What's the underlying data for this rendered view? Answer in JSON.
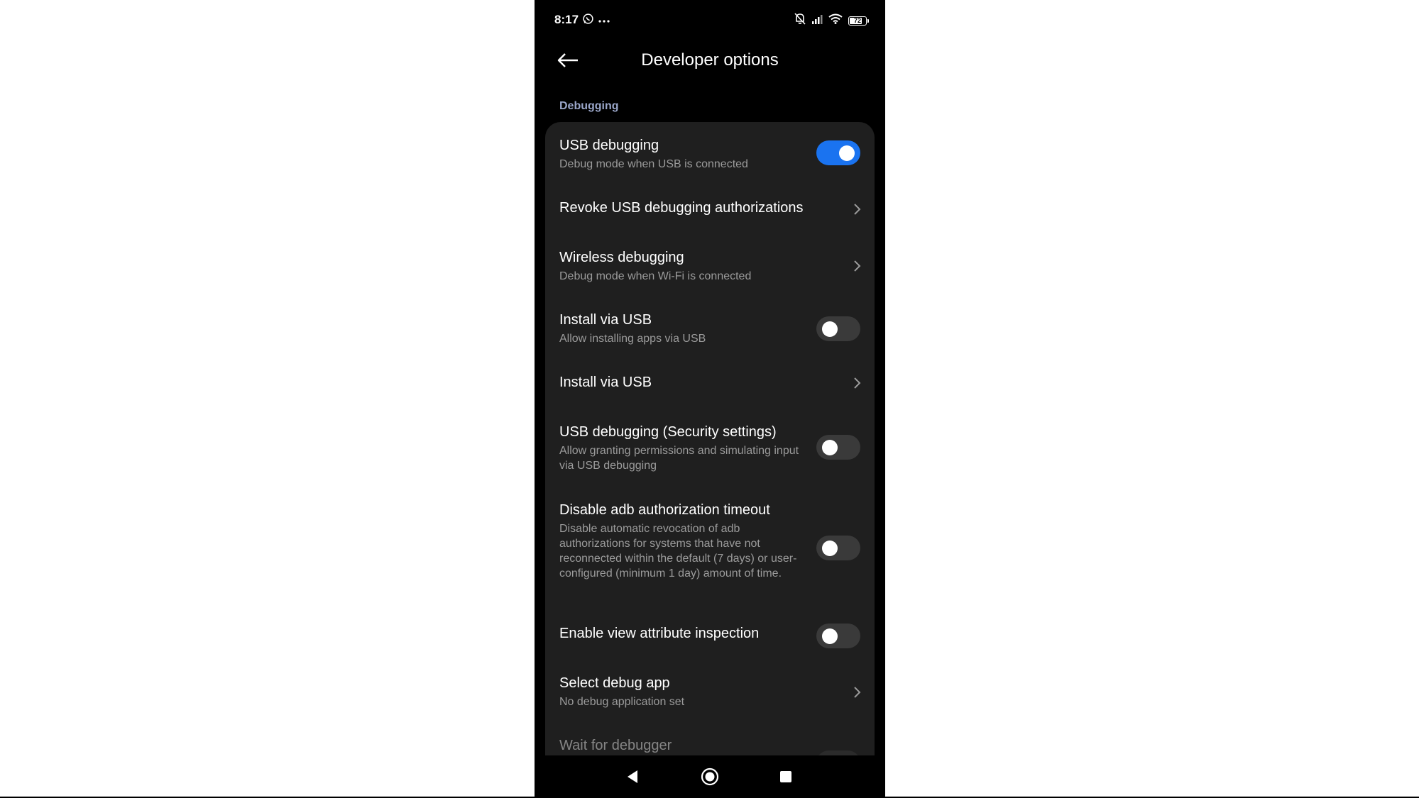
{
  "status_bar": {
    "time": "8:17",
    "left_icons": [
      "whatsapp-icon",
      "more-dots-icon"
    ],
    "right_icons": [
      "bell-muted-icon",
      "signal-icon",
      "wifi-icon",
      "battery-icon"
    ],
    "battery_level": "72"
  },
  "header": {
    "title": "Developer options",
    "back_icon": "back-arrow-icon"
  },
  "section": {
    "title": "Debugging"
  },
  "rows": [
    {
      "title": "USB debugging",
      "subtitle": "Debug mode when USB is connected",
      "control": "toggle",
      "on": true
    },
    {
      "title": "Revoke USB debugging authorizations",
      "control": "chevron"
    },
    {
      "title": "Wireless debugging",
      "subtitle": "Debug mode when Wi-Fi is connected",
      "control": "chevron"
    },
    {
      "title": "Install via USB",
      "subtitle": "Allow installing apps via USB",
      "control": "toggle",
      "on": false
    },
    {
      "title": "Install via USB",
      "control": "chevron"
    },
    {
      "title": "USB debugging (Security settings)",
      "subtitle": "Allow granting permissions and simulating input via USB debugging",
      "control": "toggle",
      "on": false
    },
    {
      "title": "Disable adb authorization timeout",
      "subtitle": "Disable automatic revocation of adb authorizations for systems that have not reconnected within the default (7 days) or user-configured (minimum 1 day) amount of time.",
      "control": "toggle",
      "on": false
    },
    {
      "title": "Enable view attribute inspection",
      "control": "toggle",
      "on": false
    },
    {
      "title": "Select debug app",
      "subtitle": "No debug application set",
      "control": "chevron"
    },
    {
      "title": "Wait for debugger",
      "control": "toggle",
      "on": false
    }
  ],
  "nav_bar": {
    "buttons": [
      "back-triangle-icon",
      "home-circle-icon",
      "recents-square-icon"
    ]
  },
  "colors": {
    "accent": "#1a73f0",
    "section_header": "#9aa6c9",
    "card_bg": "#1f1f1f",
    "background": "#000000"
  }
}
